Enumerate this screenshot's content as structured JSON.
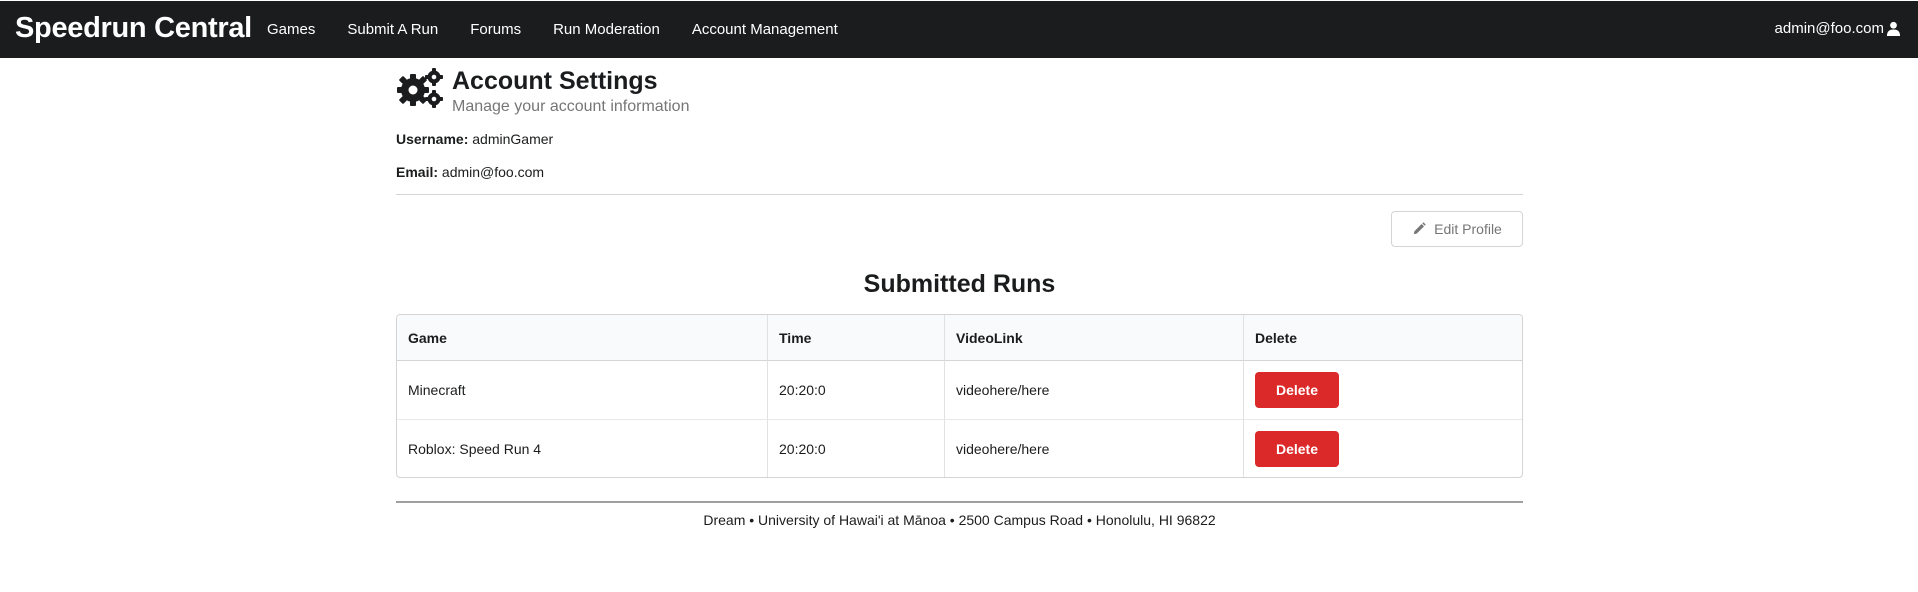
{
  "navbar": {
    "brand": "Speedrun Central",
    "items": [
      {
        "label": "Games"
      },
      {
        "label": "Submit A Run"
      },
      {
        "label": "Forums"
      },
      {
        "label": "Run Moderation"
      },
      {
        "label": "Account Management"
      }
    ],
    "user_label": "admin@foo.com",
    "user_icon": "user-icon"
  },
  "header": {
    "icon": "cogs-icon",
    "title": "Account Settings",
    "subtitle": "Manage your account information"
  },
  "profile": {
    "username_label": "Username:",
    "username_value": "adminGamer",
    "email_label": "Email:",
    "email_value": "admin@foo.com"
  },
  "edit_button": {
    "icon": "pencil-icon",
    "label": "Edit Profile"
  },
  "runs": {
    "title": "Submitted Runs",
    "columns": [
      "Game",
      "Time",
      "VideoLink",
      "Delete"
    ],
    "rows": [
      {
        "game": "Minecraft",
        "time": "20:20:0",
        "video": "videohere/here",
        "action": "Delete"
      },
      {
        "game": "Roblox: Speed Run 4",
        "time": "20:20:0",
        "video": "videohere/here",
        "action": "Delete"
      }
    ]
  },
  "footer": {
    "text": "Dream • University of Hawai'i at Mānoa • 2500 Campus Road • Honolulu, HI 96822"
  },
  "colors": {
    "navbar_bg": "#1b1c1d",
    "delete_red": "#db2828",
    "muted_text": "#767676"
  }
}
